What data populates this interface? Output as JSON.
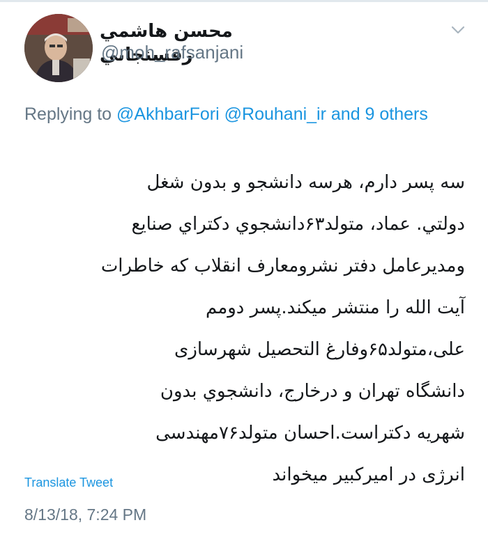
{
  "colors": {
    "link": "#1b95e0",
    "secondary_text": "#657786",
    "primary_text": "#14171a"
  },
  "author": {
    "display_name": "محسن هاشمي رفسنجاني",
    "handle": "@moh_rafsanjani",
    "avatar_icon": "profile-photo"
  },
  "menu": {
    "icon": "chevron-down-icon"
  },
  "reply": {
    "prefix": "Replying to",
    "mention_1": "@AkhbarFori",
    "mention_2": "@Rouhani_ir",
    "others": "and 9 others"
  },
  "tweet": {
    "lines": [
      "سه پسر دارم، هرسه دانشجو و بدون شغل",
      "دولتي. عماد، متولد۶۳دانشجوي دكتراي صنايع",
      "ومديرعامل دفتر نشرومعارف انقلاب كه خاطرات",
      "آيت الله را منتشر ميكند.پسر دومم",
      "علی،متولد۶۵وفارغ التحصيل شهرسازی",
      "دانشگاه تهران و درخارج، دانشجوي بدون",
      "شهريه دكتراست.احسان متولد۷۶مهندسی",
      "انرژی در اميركبير ميخواند"
    ]
  },
  "translate_label": "Translate Tweet",
  "timestamp": "8/13/18, 7:24 PM"
}
